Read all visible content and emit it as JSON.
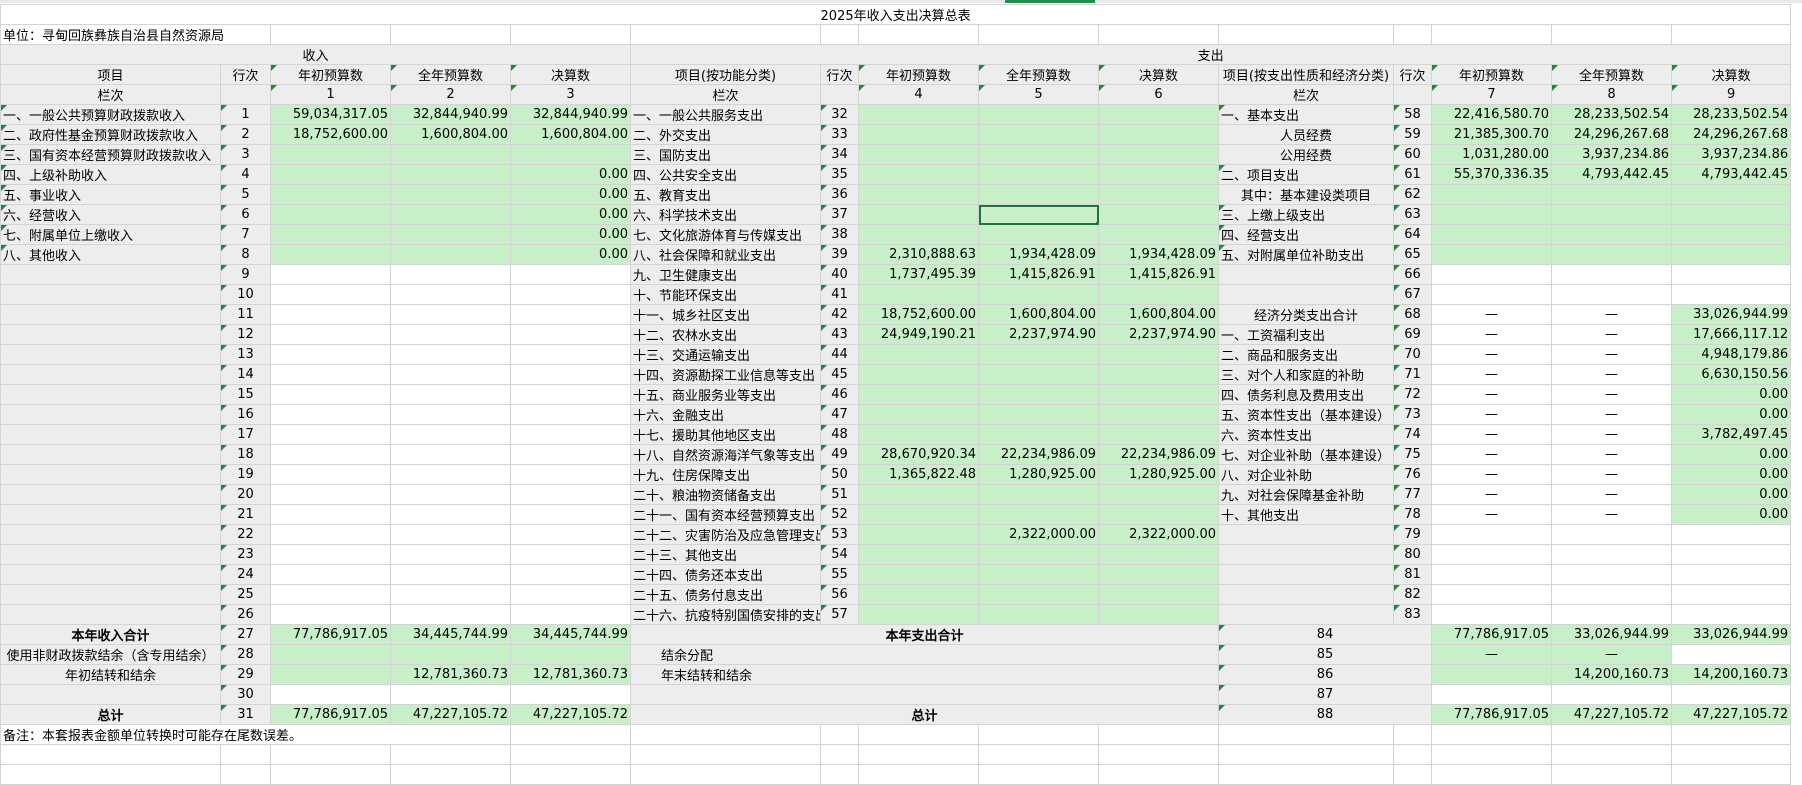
{
  "title": "2025年收入支出决算总表",
  "unit": "单位：寻甸回族彝族自治县自然资源局",
  "section_income": "收入",
  "section_expense": "支出",
  "headers": {
    "item": "项目",
    "row_no": "行次",
    "col_begin_budget": "年初预算数",
    "col_full_budget": "全年预算数",
    "col_final": "决算数",
    "func_item": "项目(按功能分类)",
    "econ_item": "项目(按支出性质和经济分类)",
    "lanci": "栏次",
    "income_col_nums": [
      "1",
      "2",
      "3"
    ],
    "func_col_nums": [
      "4",
      "5",
      "6"
    ],
    "econ_col_nums": [
      "7",
      "8",
      "9"
    ]
  },
  "income_rows": [
    {
      "name": "一、一般公共预算财政拨款收入",
      "no": "1",
      "a": "59,034,317.05",
      "b": "32,844,940.99",
      "c": "32,844,940.99"
    },
    {
      "name": "二、政府性基金预算财政拨款收入",
      "no": "2",
      "a": "18,752,600.00",
      "b": "1,600,804.00",
      "c": "1,600,804.00"
    },
    {
      "name": "三、国有资本经营预算财政拨款收入",
      "no": "3",
      "a": "",
      "b": "",
      "c": ""
    },
    {
      "name": "四、上级补助收入",
      "no": "4",
      "a": "",
      "b": "",
      "c": "0.00"
    },
    {
      "name": "五、事业收入",
      "no": "5",
      "a": "",
      "b": "",
      "c": "0.00"
    },
    {
      "name": "六、经营收入",
      "no": "6",
      "a": "",
      "b": "",
      "c": "0.00"
    },
    {
      "name": "七、附属单位上缴收入",
      "no": "7",
      "a": "",
      "b": "",
      "c": "0.00"
    },
    {
      "name": "八、其他收入",
      "no": "8",
      "a": "",
      "b": "",
      "c": "0.00"
    },
    {
      "name": "",
      "no": "9",
      "a": "",
      "b": "",
      "c": ""
    },
    {
      "name": "",
      "no": "10",
      "a": "",
      "b": "",
      "c": ""
    },
    {
      "name": "",
      "no": "11",
      "a": "",
      "b": "",
      "c": ""
    },
    {
      "name": "",
      "no": "12",
      "a": "",
      "b": "",
      "c": ""
    },
    {
      "name": "",
      "no": "13",
      "a": "",
      "b": "",
      "c": ""
    },
    {
      "name": "",
      "no": "14",
      "a": "",
      "b": "",
      "c": ""
    },
    {
      "name": "",
      "no": "15",
      "a": "",
      "b": "",
      "c": ""
    },
    {
      "name": "",
      "no": "16",
      "a": "",
      "b": "",
      "c": ""
    },
    {
      "name": "",
      "no": "17",
      "a": "",
      "b": "",
      "c": ""
    },
    {
      "name": "",
      "no": "18",
      "a": "",
      "b": "",
      "c": ""
    },
    {
      "name": "",
      "no": "19",
      "a": "",
      "b": "",
      "c": ""
    },
    {
      "name": "",
      "no": "20",
      "a": "",
      "b": "",
      "c": ""
    },
    {
      "name": "",
      "no": "21",
      "a": "",
      "b": "",
      "c": ""
    },
    {
      "name": "",
      "no": "22",
      "a": "",
      "b": "",
      "c": ""
    },
    {
      "name": "",
      "no": "23",
      "a": "",
      "b": "",
      "c": ""
    },
    {
      "name": "",
      "no": "24",
      "a": "",
      "b": "",
      "c": ""
    },
    {
      "name": "",
      "no": "25",
      "a": "",
      "b": "",
      "c": ""
    },
    {
      "name": "",
      "no": "26",
      "a": "",
      "b": "",
      "c": ""
    }
  ],
  "func_rows": [
    {
      "name": "一、一般公共服务支出",
      "no": "32",
      "a": "",
      "b": "",
      "c": ""
    },
    {
      "name": "二、外交支出",
      "no": "33",
      "a": "",
      "b": "",
      "c": ""
    },
    {
      "name": "三、国防支出",
      "no": "34",
      "a": "",
      "b": "",
      "c": ""
    },
    {
      "name": "四、公共安全支出",
      "no": "35",
      "a": "",
      "b": "",
      "c": ""
    },
    {
      "name": "五、教育支出",
      "no": "36",
      "a": "",
      "b": "",
      "c": ""
    },
    {
      "name": "六、科学技术支出",
      "no": "37",
      "a": "",
      "b": "",
      "c": ""
    },
    {
      "name": "七、文化旅游体育与传媒支出",
      "no": "38",
      "a": "",
      "b": "",
      "c": ""
    },
    {
      "name": "八、社会保障和就业支出",
      "no": "39",
      "a": "2,310,888.63",
      "b": "1,934,428.09",
      "c": "1,934,428.09"
    },
    {
      "name": "九、卫生健康支出",
      "no": "40",
      "a": "1,737,495.39",
      "b": "1,415,826.91",
      "c": "1,415,826.91"
    },
    {
      "name": "十、节能环保支出",
      "no": "41",
      "a": "",
      "b": "",
      "c": ""
    },
    {
      "name": "十一、城乡社区支出",
      "no": "42",
      "a": "18,752,600.00",
      "b": "1,600,804.00",
      "c": "1,600,804.00"
    },
    {
      "name": "十二、农林水支出",
      "no": "43",
      "a": "24,949,190.21",
      "b": "2,237,974.90",
      "c": "2,237,974.90"
    },
    {
      "name": "十三、交通运输支出",
      "no": "44",
      "a": "",
      "b": "",
      "c": ""
    },
    {
      "name": "十四、资源勘探工业信息等支出",
      "no": "45",
      "a": "",
      "b": "",
      "c": ""
    },
    {
      "name": "十五、商业服务业等支出",
      "no": "46",
      "a": "",
      "b": "",
      "c": ""
    },
    {
      "name": "十六、金融支出",
      "no": "47",
      "a": "",
      "b": "",
      "c": ""
    },
    {
      "name": "十七、援助其他地区支出",
      "no": "48",
      "a": "",
      "b": "",
      "c": ""
    },
    {
      "name": "十八、自然资源海洋气象等支出",
      "no": "49",
      "a": "28,670,920.34",
      "b": "22,234,986.09",
      "c": "22,234,986.09"
    },
    {
      "name": "十九、住房保障支出",
      "no": "50",
      "a": "1,365,822.48",
      "b": "1,280,925.00",
      "c": "1,280,925.00"
    },
    {
      "name": "二十、粮油物资储备支出",
      "no": "51",
      "a": "",
      "b": "",
      "c": ""
    },
    {
      "name": "二十一、国有资本经营预算支出",
      "no": "52",
      "a": "",
      "b": "",
      "c": ""
    },
    {
      "name": "二十二、灾害防治及应急管理支出",
      "no": "53",
      "a": "",
      "b": "2,322,000.00",
      "c": "2,322,000.00"
    },
    {
      "name": "二十三、其他支出",
      "no": "54",
      "a": "",
      "b": "",
      "c": ""
    },
    {
      "name": "二十四、债务还本支出",
      "no": "55",
      "a": "",
      "b": "",
      "c": ""
    },
    {
      "name": "二十五、债务付息支出",
      "no": "56",
      "a": "",
      "b": "",
      "c": ""
    },
    {
      "name": "二十六、抗疫特别国债安排的支出",
      "no": "57",
      "a": "",
      "b": "",
      "c": ""
    }
  ],
  "econ_rows": [
    {
      "name": "一、基本支出",
      "no": "58",
      "a": "22,416,580.70",
      "b": "28,233,502.54",
      "c": "28,233,502.54"
    },
    {
      "name": "人员经费",
      "no": "59",
      "a": "21,385,300.70",
      "b": "24,296,267.68",
      "c": "24,296,267.68"
    },
    {
      "name": "公用经费",
      "no": "60",
      "a": "1,031,280.00",
      "b": "3,937,234.86",
      "c": "3,937,234.86"
    },
    {
      "name": "二、项目支出",
      "no": "61",
      "a": "55,370,336.35",
      "b": "4,793,442.45",
      "c": "4,793,442.45"
    },
    {
      "name": "其中：基本建设类项目",
      "no": "62",
      "a": "",
      "b": "",
      "c": ""
    },
    {
      "name": "三、上缴上级支出",
      "no": "63",
      "a": "",
      "b": "",
      "c": ""
    },
    {
      "name": "四、经营支出",
      "no": "64",
      "a": "",
      "b": "",
      "c": ""
    },
    {
      "name": "五、对附属单位补助支出",
      "no": "65",
      "a": "",
      "b": "",
      "c": ""
    },
    {
      "name": "",
      "no": "66",
      "a": "",
      "b": "",
      "c": ""
    },
    {
      "name": "",
      "no": "67",
      "a": "",
      "b": "",
      "c": ""
    },
    {
      "name": "经济分类支出合计",
      "no": "68",
      "a": "—",
      "b": "—",
      "c": "33,026,944.99"
    },
    {
      "name": "一、工资福利支出",
      "no": "69",
      "a": "—",
      "b": "—",
      "c": "17,666,117.12"
    },
    {
      "name": "二、商品和服务支出",
      "no": "70",
      "a": "—",
      "b": "—",
      "c": "4,948,179.86"
    },
    {
      "name": "三、对个人和家庭的补助",
      "no": "71",
      "a": "—",
      "b": "—",
      "c": "6,630,150.56"
    },
    {
      "name": "四、债务利息及费用支出",
      "no": "72",
      "a": "—",
      "b": "—",
      "c": "0.00"
    },
    {
      "name": "五、资本性支出（基本建设）",
      "no": "73",
      "a": "—",
      "b": "—",
      "c": "0.00"
    },
    {
      "name": "六、资本性支出",
      "no": "74",
      "a": "—",
      "b": "—",
      "c": "3,782,497.45"
    },
    {
      "name": "七、对企业补助（基本建设）",
      "no": "75",
      "a": "—",
      "b": "—",
      "c": "0.00"
    },
    {
      "name": "八、对企业补助",
      "no": "76",
      "a": "—",
      "b": "—",
      "c": "0.00"
    },
    {
      "name": "九、对社会保障基金补助",
      "no": "77",
      "a": "—",
      "b": "—",
      "c": "0.00"
    },
    {
      "name": "十、其他支出",
      "no": "78",
      "a": "—",
      "b": "—",
      "c": "0.00"
    },
    {
      "name": "",
      "no": "79",
      "a": "",
      "b": "",
      "c": ""
    },
    {
      "name": "",
      "no": "80",
      "a": "",
      "b": "",
      "c": ""
    },
    {
      "name": "",
      "no": "81",
      "a": "",
      "b": "",
      "c": ""
    },
    {
      "name": "",
      "no": "82",
      "a": "",
      "b": "",
      "c": ""
    },
    {
      "name": "",
      "no": "83",
      "a": "",
      "b": "",
      "c": ""
    }
  ],
  "summary_rows": [
    {
      "in_name": "本年收入合计",
      "in_no": "27",
      "in_a": "77,786,917.05",
      "in_b": "34,445,744.99",
      "in_c": "34,445,744.99",
      "out_name": "本年支出合计",
      "out_no": "84",
      "out_a": "77,786,917.05",
      "out_b": "33,026,944.99",
      "out_c": "33,026,944.99"
    },
    {
      "in_name": "使用非财政拨款结余（含专用结余）",
      "in_no": "28",
      "in_a": "",
      "in_b": "",
      "in_c": "",
      "out_name": "结余分配",
      "out_no": "85",
      "out_a": "—",
      "out_b": "—",
      "out_c": ""
    },
    {
      "in_name": "年初结转和结余",
      "in_no": "29",
      "in_a": "",
      "in_b": "12,781,360.73",
      "in_c": "12,781,360.73",
      "out_name": "年末结转和结余",
      "out_no": "86",
      "out_a": "",
      "out_b": "14,200,160.73",
      "out_c": "14,200,160.73"
    },
    {
      "in_name": "",
      "in_no": "30",
      "in_a": "",
      "in_b": "",
      "in_c": "",
      "out_name": "",
      "out_no": "87",
      "out_a": "",
      "out_b": "",
      "out_c": ""
    },
    {
      "in_name": "总计",
      "in_no": "31",
      "in_a": "77,786,917.05",
      "in_b": "47,227,105.72",
      "in_c": "47,227,105.72",
      "out_name": "总计",
      "out_no": "88",
      "out_a": "77,786,917.05",
      "out_b": "47,227,105.72",
      "out_c": "47,227,105.72"
    }
  ],
  "note": "备注：本套报表金额单位转换时可能存在尾数误差。",
  "colors": {
    "input_green": "#c8f0c8",
    "label_gray": "#ededed",
    "selection": "#217346"
  }
}
